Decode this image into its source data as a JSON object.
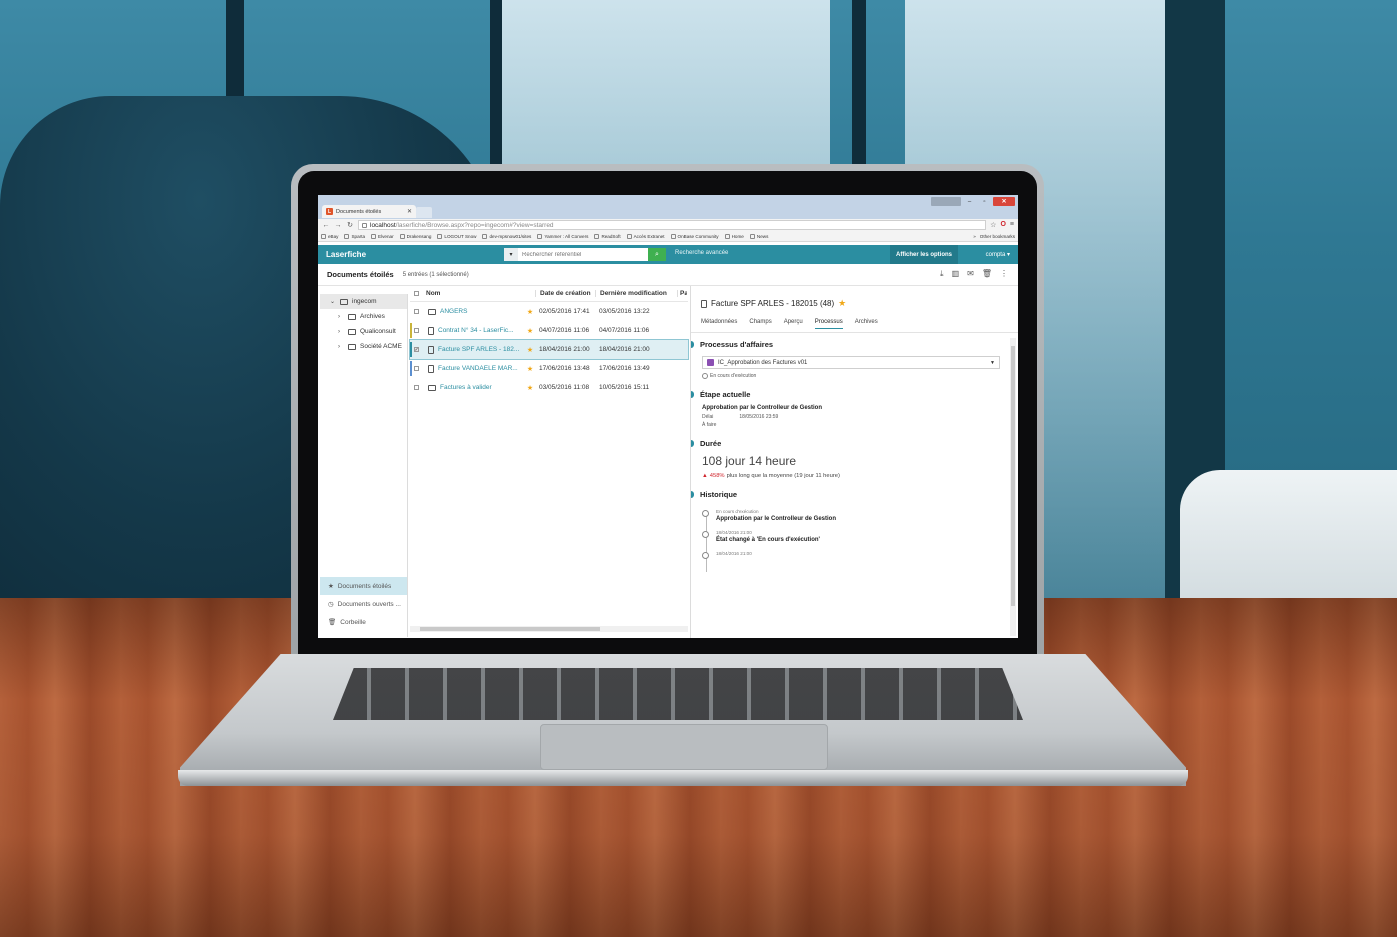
{
  "browser": {
    "tab_title": "Documents étoilés",
    "url_host": "localhost",
    "url_path": "/laserfiche/Browse.aspx?repo=ingecom#?view=starred",
    "bookmarks": [
      "eBay",
      "Sparta",
      "Elvenar",
      "Drakensang",
      "LOGOUT Snow",
      "dev-mpsnow01/sites",
      "Yammer : All Convers",
      "ReadSoft",
      "Accès Extranet",
      "OnBase Community",
      "Home",
      "News"
    ],
    "other_bookmarks": "Other bookmarks"
  },
  "app": {
    "logo": "Laserfiche",
    "search_placeholder": "Rechercher référentiel",
    "advanced_search": "Recherche avancée",
    "options_button": "Afficher les options",
    "user": "compta"
  },
  "toolbar": {
    "title": "Documents étoilés",
    "count": "5 entrées (1 sélectionné)"
  },
  "tree": {
    "root": "ingecom",
    "children": [
      "Archives",
      "Qualiconsult",
      "Société ACME"
    ],
    "bottom": [
      "Documents étoilés",
      "Documents ouverts ...",
      "Corbeille"
    ]
  },
  "list": {
    "headers": {
      "name": "Nom",
      "created": "Date de création",
      "modified": "Dernière modification",
      "extra": "Pa"
    },
    "rows": [
      {
        "name": "ANGERS",
        "created": "02/05/2016 17:41",
        "modified": "03/05/2016 13:22",
        "type": "folder",
        "mark": ""
      },
      {
        "name": "Contrat N° 34 - LaserFic...",
        "created": "04/07/2016 11:06",
        "modified": "04/07/2016 11:06",
        "type": "doc",
        "mark": "#c9b43a"
      },
      {
        "name": "Facture SPF ARLES - 182...",
        "created": "18/04/2016 21:00",
        "modified": "18/04/2016 21:00",
        "type": "doc",
        "mark": "#2b8ea1"
      },
      {
        "name": "Facture VANDAELE MAR...",
        "created": "17/06/2016 13:48",
        "modified": "17/06/2016 13:49",
        "type": "doc",
        "mark": "#5b8fd0"
      },
      {
        "name": "Factures à valider",
        "created": "03/05/2016 11:08",
        "modified": "10/05/2016 15:11",
        "type": "folder",
        "mark": ""
      }
    ]
  },
  "panel": {
    "title": "Facture SPF ARLES - 182015 (48)",
    "tabs": [
      "Métadonnées",
      "Champs",
      "Aperçu",
      "Processus",
      "Archives"
    ],
    "active_tab": "Processus",
    "business_process": {
      "heading": "Processus d'affaires",
      "name": "IC_Approbation des Factures v01",
      "state": "En cours d'exécution"
    },
    "current_step": {
      "heading": "Étape actuelle",
      "name": "Approbation par le Controlleur de Gestion",
      "delay_label": "Délai",
      "delay_value": "18/05/2016 23:59",
      "todo": "À faire"
    },
    "duration": {
      "heading": "Durée",
      "value": "108 jour 14 heure",
      "percent": "458%",
      "note": "plus long que la moyenne (19 jour 11 heure)"
    },
    "history": {
      "heading": "Historique",
      "items": [
        {
          "sub": "En cours d'exécution",
          "main": "Approbation par le Controlleur de Gestion"
        },
        {
          "sub": "18/04/2016 21:00",
          "main": "État changé à 'En cours d'exécution'"
        },
        {
          "sub": "18/04/2016 21:00",
          "main": ""
        }
      ]
    }
  },
  "colors": {
    "accent": "#2b8ea1",
    "star": "#f0a818",
    "search_button": "#3fb050"
  }
}
